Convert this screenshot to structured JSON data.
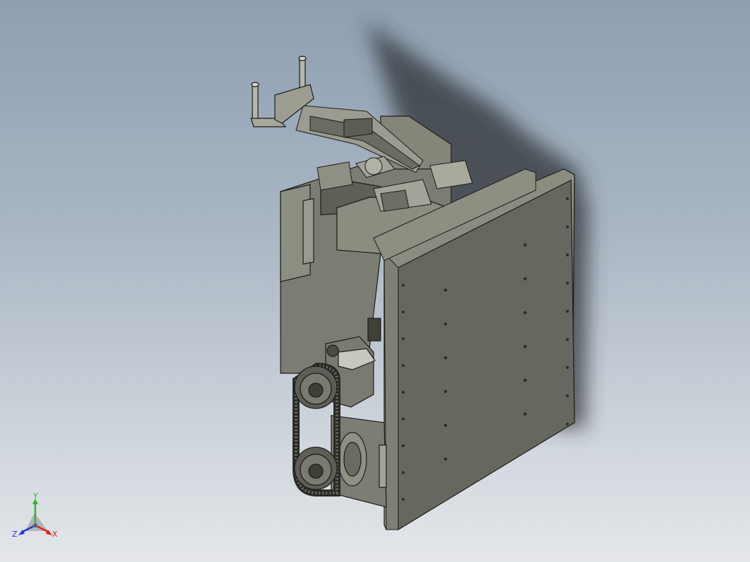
{
  "viewport": {
    "background_top": "#8e9fb2",
    "background_bottom": "#e4e7ea",
    "model_name": ""
  },
  "triad": {
    "x_label": "X",
    "y_label": "Y",
    "z_label": "Z",
    "x_color": "#e0241b",
    "y_color": "#2fb52a",
    "z_color": "#2837d6"
  },
  "colors": {
    "part_light": "#8a8b7f",
    "part_mid": "#6e6f64",
    "part_dark": "#4a4b44",
    "plate_face": "#66675f",
    "edge": "#1c1c1a",
    "shadow": "#2f3136"
  }
}
